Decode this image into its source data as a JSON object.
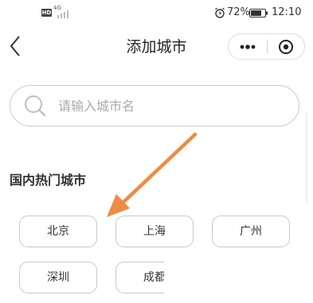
{
  "status_bar": {
    "hd": "HD",
    "network": "4G",
    "battery": "72%",
    "time": "12:10"
  },
  "nav": {
    "title": "添加城市"
  },
  "search": {
    "placeholder": "请输入城市名",
    "value": ""
  },
  "section": {
    "title": "国内热门城市"
  },
  "cities": [
    "北京",
    "上海",
    "广州",
    "深圳",
    "成都"
  ],
  "colors": {
    "arrow": "#ef8b43",
    "border": "#c8c8c8",
    "text": "#333333"
  },
  "icons": [
    "back-arrow-icon",
    "more-dots-icon",
    "target-close-icon",
    "search-icon",
    "alarm-icon",
    "battery-icon",
    "signal-icon"
  ]
}
